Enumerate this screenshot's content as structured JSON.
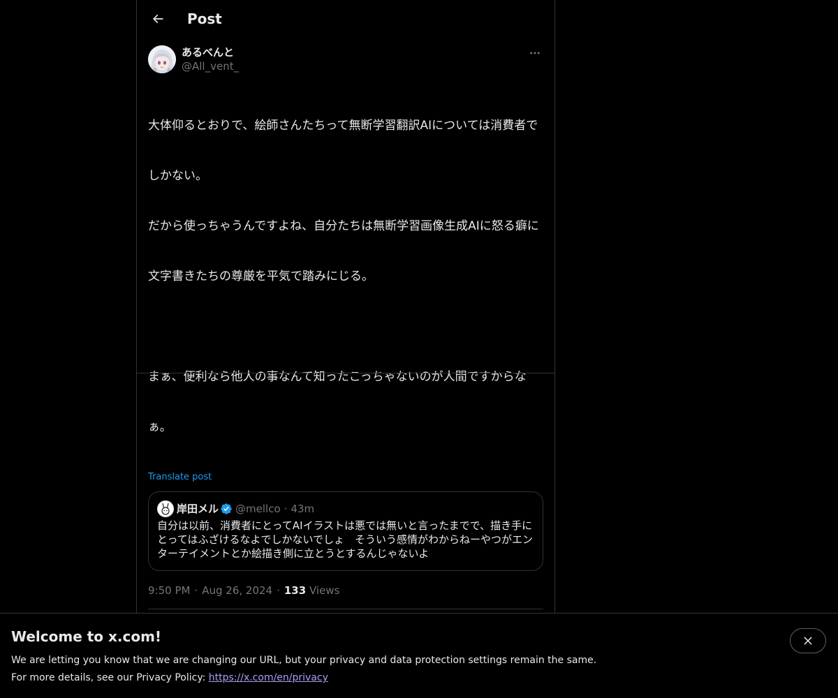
{
  "header": {
    "title": "Post"
  },
  "post": {
    "display_name": "あるべんと",
    "handle": "@All_vent_",
    "text_lines": [
      "大体仰るとおりで、絵師さんたちって無断学習翻訳AIについては消費者で",
      "しかない。",
      "だから使っちゃうんですよね、自分たちは無断学習画像生成AIに怒る癖に",
      "文字書きたちの尊厳を平気で踏みにじる。",
      "",
      "まぁ、便利なら他人の事なんて知ったこっちゃないのが人間ですからな",
      "ぁ。"
    ],
    "translate_label": "Translate post",
    "time": "9:50 PM",
    "date": "Aug 26, 2024",
    "views_count": "133",
    "views_label": "Views"
  },
  "quote": {
    "display_name": "岸田メル",
    "handle": "@mellco",
    "time": "43m",
    "text_lines": [
      "自分は以前、消費者にとってAIイラストは悪では無いと言ったまでで、描き手に",
      "とってはふざけるなよでしかないでしょ　そういう感情がわからねーやつがエン",
      "ターテイメントとか絵描き側に立とうとするんじゃないよ"
    ]
  },
  "banner": {
    "title": "Welcome to x.com!",
    "line1": "We are letting you know that we are changing our URL, but your privacy and data protection settings remain the same.",
    "line2_prefix": "For more details, see our Privacy Policy: ",
    "link": "https://x.com/en/privacy"
  },
  "icons": {
    "back": "arrow-left-icon",
    "more": "more-horizontal-icon",
    "reply": "reply-icon",
    "repost": "repost-icon",
    "like": "heart-icon",
    "bookmark": "bookmark-icon",
    "share": "share-icon",
    "close": "close-icon",
    "verified": "verified-badge-icon"
  },
  "colors": {
    "background": "#000000",
    "text": "#e7e9ea",
    "secondary": "#71767b",
    "accent": "#1d9bf0",
    "border": "#2f3336",
    "link": "#a7a0f5"
  }
}
